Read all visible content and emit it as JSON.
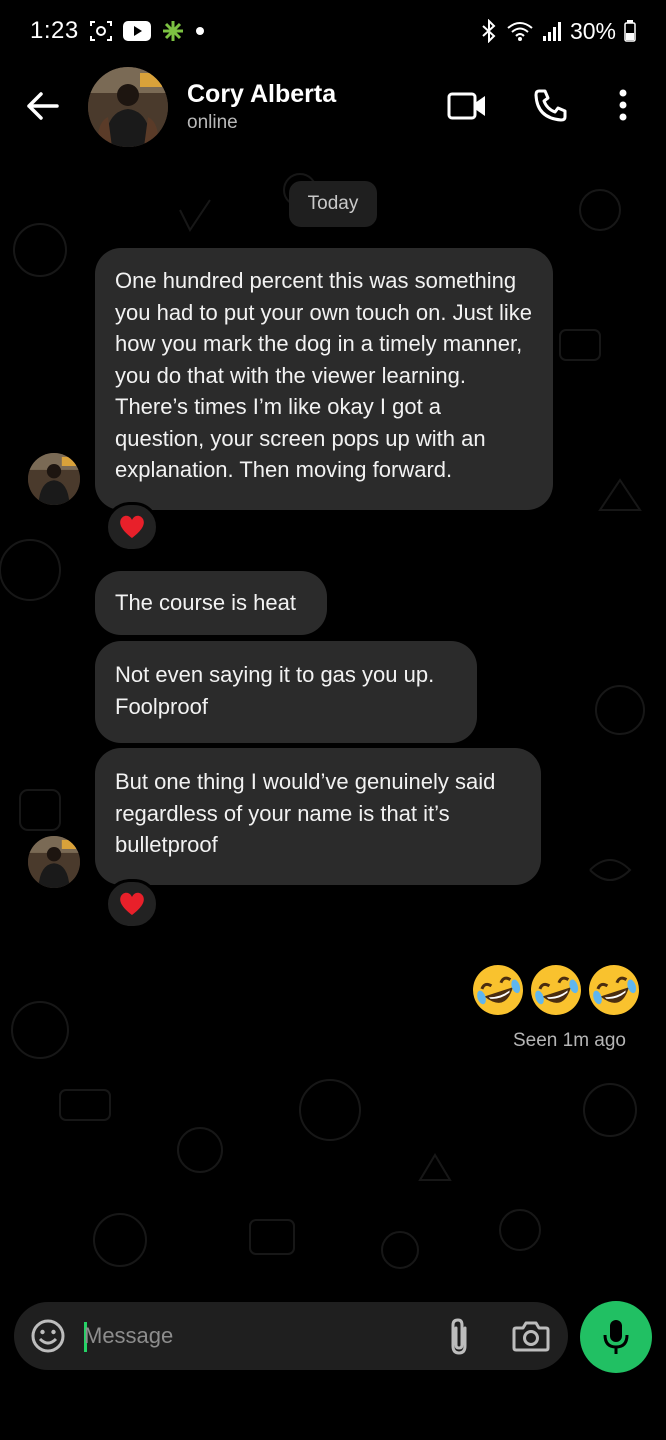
{
  "status_bar": {
    "time": "1:23",
    "battery": "30%"
  },
  "header": {
    "contact_name": "Cory Alberta",
    "contact_status": "online"
  },
  "chat": {
    "date_separator": "Today",
    "messages": [
      {
        "text": "One hundred percent this was something you had to put your own touch on. Just like how you mark the dog in a timely manner, you do that with the viewer learning. There’s times I’m like okay I got a question, your screen pops up with an explanation. Then moving forward.",
        "reaction": "heart"
      },
      {
        "text": "The course is heat"
      },
      {
        "text": "Not even saying it to gas you up.\nFoolproof"
      },
      {
        "text": "But one thing I would’ve genuinely said regardless of your name is that it’s bulletproof",
        "reaction": "heart"
      }
    ],
    "outgoing": {
      "emoji": "🤣🤣🤣",
      "seen": "Seen 1m ago"
    }
  },
  "composer": {
    "placeholder": "Message"
  },
  "colors": {
    "background": "#000000",
    "bubble": "#2b2b2b",
    "accent": "#21c063"
  },
  "icons": [
    "back-arrow-icon",
    "video-call-icon",
    "phone-icon",
    "more-vert-icon",
    "emoji-icon",
    "attach-icon",
    "camera-icon",
    "mic-icon",
    "heart-icon",
    "laughing-emoji-icon"
  ]
}
